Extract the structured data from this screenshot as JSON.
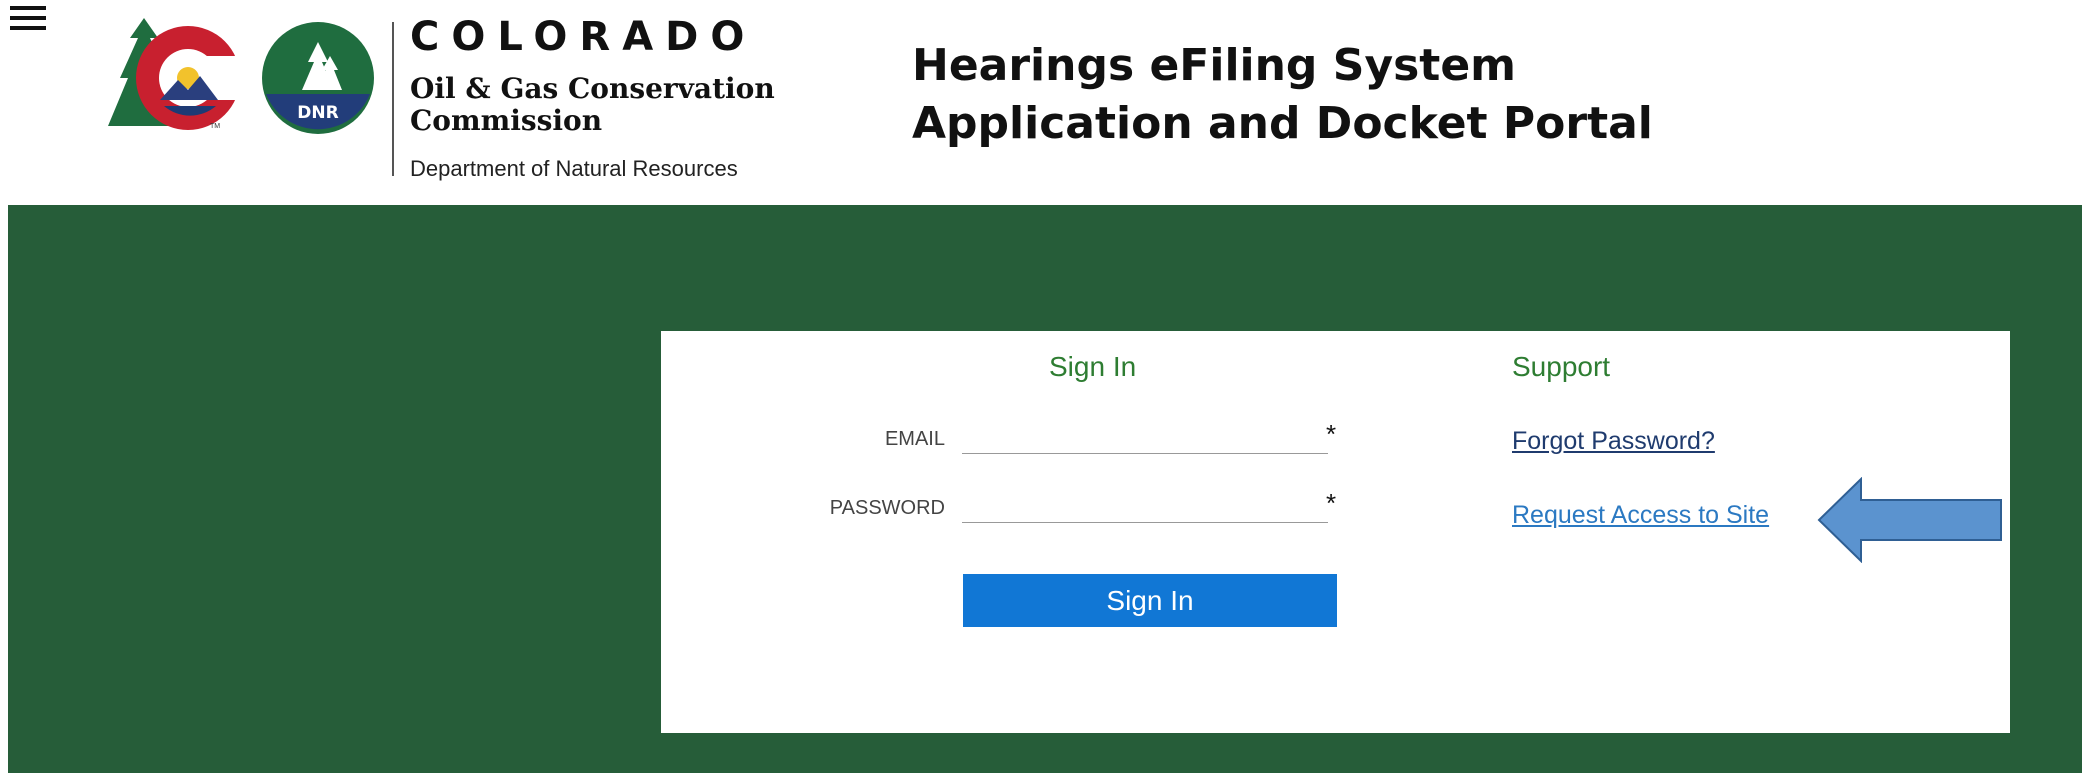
{
  "header": {
    "menu_icon": "hamburger-menu-icon",
    "brand": "COLORADO",
    "agency_line1": "Oil & Gas Conservation",
    "agency_line2": "Commission",
    "department": "Department of Natural Resources",
    "logo_badge": "DNR",
    "logo_tm": "TM",
    "title_line1": "Hearings eFiling System",
    "title_line2": "Application and Docket Portal"
  },
  "signin": {
    "heading": "Sign In",
    "email_label": "EMAIL",
    "email_value": "",
    "password_label": "PASSWORD",
    "password_value": "",
    "required_marker": "*",
    "button_label": "Sign In"
  },
  "support": {
    "heading": "Support",
    "forgot_password": "Forgot Password?",
    "request_access": "Request Access to Site"
  },
  "colors": {
    "band_green": "#265d39",
    "heading_green": "#2e7d32",
    "button_blue": "#1177d5",
    "link_navy": "#1f3b6e",
    "link_blue": "#2b79c2",
    "arrow_blue": "#5b93cf"
  },
  "annotation": {
    "arrow_icon": "left-arrow-icon"
  }
}
